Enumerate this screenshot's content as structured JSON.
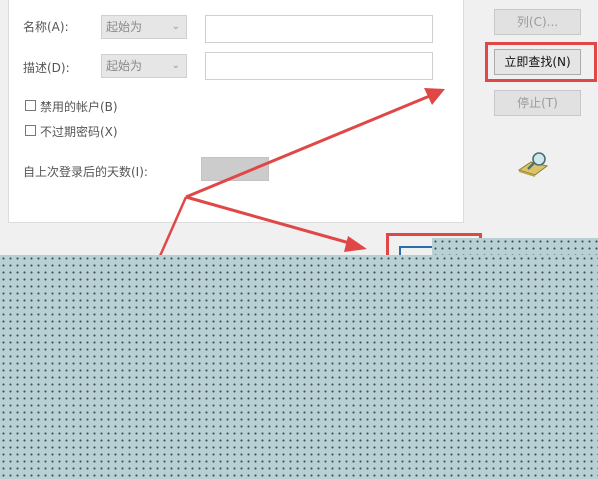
{
  "form": {
    "name_label": "名称(A):",
    "name_combo": "起始为",
    "name_value": "",
    "desc_label": "描述(D):",
    "desc_combo": "起始为",
    "desc_value": "",
    "disabled_label": "禁用的帐户(B)",
    "noexpire_label": "不过期密码(X)",
    "days_label": "自上次登录后的天数(I):",
    "days_value": ""
  },
  "buttons": {
    "columns": "列(C)...",
    "find_now": "立即查找(N)",
    "stop": "停止(T)"
  },
  "colors": {
    "annotation": "#e04848",
    "pattern": "#b8cfd4"
  },
  "icons": {
    "search": "search-icon"
  }
}
